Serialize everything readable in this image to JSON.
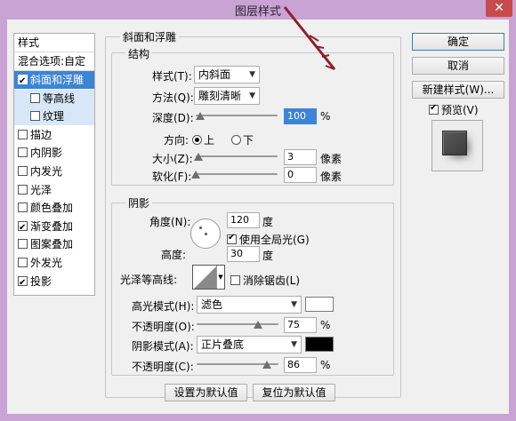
{
  "window": {
    "title": "图层样式",
    "close_glyph": "✕"
  },
  "left_panel": {
    "header": "样式",
    "blend": "混合选项:自定",
    "items": [
      {
        "label": "斜面和浮雕",
        "checked": true
      },
      {
        "label": "等高线",
        "checked": false
      },
      {
        "label": "纹理",
        "checked": false
      },
      {
        "label": "描边",
        "checked": false
      },
      {
        "label": "内阴影",
        "checked": false
      },
      {
        "label": "内发光",
        "checked": false
      },
      {
        "label": "光泽",
        "checked": false
      },
      {
        "label": "颜色叠加",
        "checked": false
      },
      {
        "label": "渐变叠加",
        "checked": true
      },
      {
        "label": "图案叠加",
        "checked": false
      },
      {
        "label": "外发光",
        "checked": false
      },
      {
        "label": "投影",
        "checked": true
      }
    ]
  },
  "bevel": {
    "section_title": "斜面和浮雕",
    "structure_title": "结构",
    "style_label": "样式(T):",
    "style_value": "内斜面",
    "technique_label": "方法(Q):",
    "technique_value": "雕刻清晰",
    "depth_label": "深度(D):",
    "depth_value": "100",
    "depth_unit": "%",
    "depth_level": 0.05,
    "direction_label": "方向:",
    "dir_up": "上",
    "dir_down": "下",
    "size_label": "大小(Z):",
    "size_value": "3",
    "size_unit": "像素",
    "size_level": 0.03,
    "soften_label": "软化(F):",
    "soften_value": "0",
    "soften_unit": "像素",
    "soften_level": 0.0
  },
  "shading": {
    "title": "阴影",
    "angle_label": "角度(N):",
    "angle_value": "120",
    "angle_unit": "度",
    "global_light_label": "使用全局光(G)",
    "altitude_label": "高度:",
    "altitude_value": "30",
    "altitude_unit": "度",
    "gloss_label": "光泽等高线:",
    "antialias_label": "消除锯齿(L)",
    "highlight_mode_label": "高光模式(H):",
    "highlight_mode_value": "滤色",
    "highlight_color": "#ffffff",
    "highlight_opacity_label": "不透明度(O):",
    "highlight_opacity_value": "75",
    "highlight_opacity_unit": "%",
    "highlight_opacity_level": 0.75,
    "shadow_mode_label": "阴影模式(A):",
    "shadow_mode_value": "正片叠底",
    "shadow_color": "#000000",
    "shadow_opacity_label": "不透明度(C):",
    "shadow_opacity_value": "86",
    "shadow_opacity_unit": "%",
    "shadow_opacity_level": 0.86
  },
  "bottom_buttons": {
    "make_default": "设置为默认值",
    "reset_default": "复位为默认值"
  },
  "right_panel": {
    "ok": "确定",
    "cancel": "取消",
    "new_style": "新建样式(W)...",
    "preview_label": "预览(V)"
  }
}
